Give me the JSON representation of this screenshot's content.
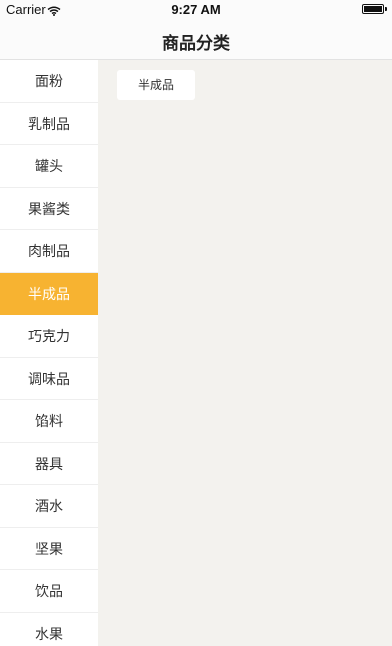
{
  "status_bar": {
    "carrier": "Carrier",
    "time": "9:27 AM",
    "wifi_icon": "wifi-icon",
    "battery_icon": "battery-icon"
  },
  "nav": {
    "title": "商品分类"
  },
  "categories": [
    {
      "label": "面粉"
    },
    {
      "label": "乳制品"
    },
    {
      "label": "罐头"
    },
    {
      "label": "果酱类"
    },
    {
      "label": "肉制品"
    },
    {
      "label": "半成品"
    },
    {
      "label": "巧克力"
    },
    {
      "label": "调味品"
    },
    {
      "label": "馅料"
    },
    {
      "label": "器具"
    },
    {
      "label": "酒水"
    },
    {
      "label": "坚果"
    },
    {
      "label": "饮品"
    },
    {
      "label": "水果"
    }
  ],
  "selected_category": "半成品",
  "subcategories": [
    {
      "label": "半成品"
    }
  ],
  "colors": {
    "accent": "#f7b331",
    "content_bg": "#f3f2ee"
  }
}
